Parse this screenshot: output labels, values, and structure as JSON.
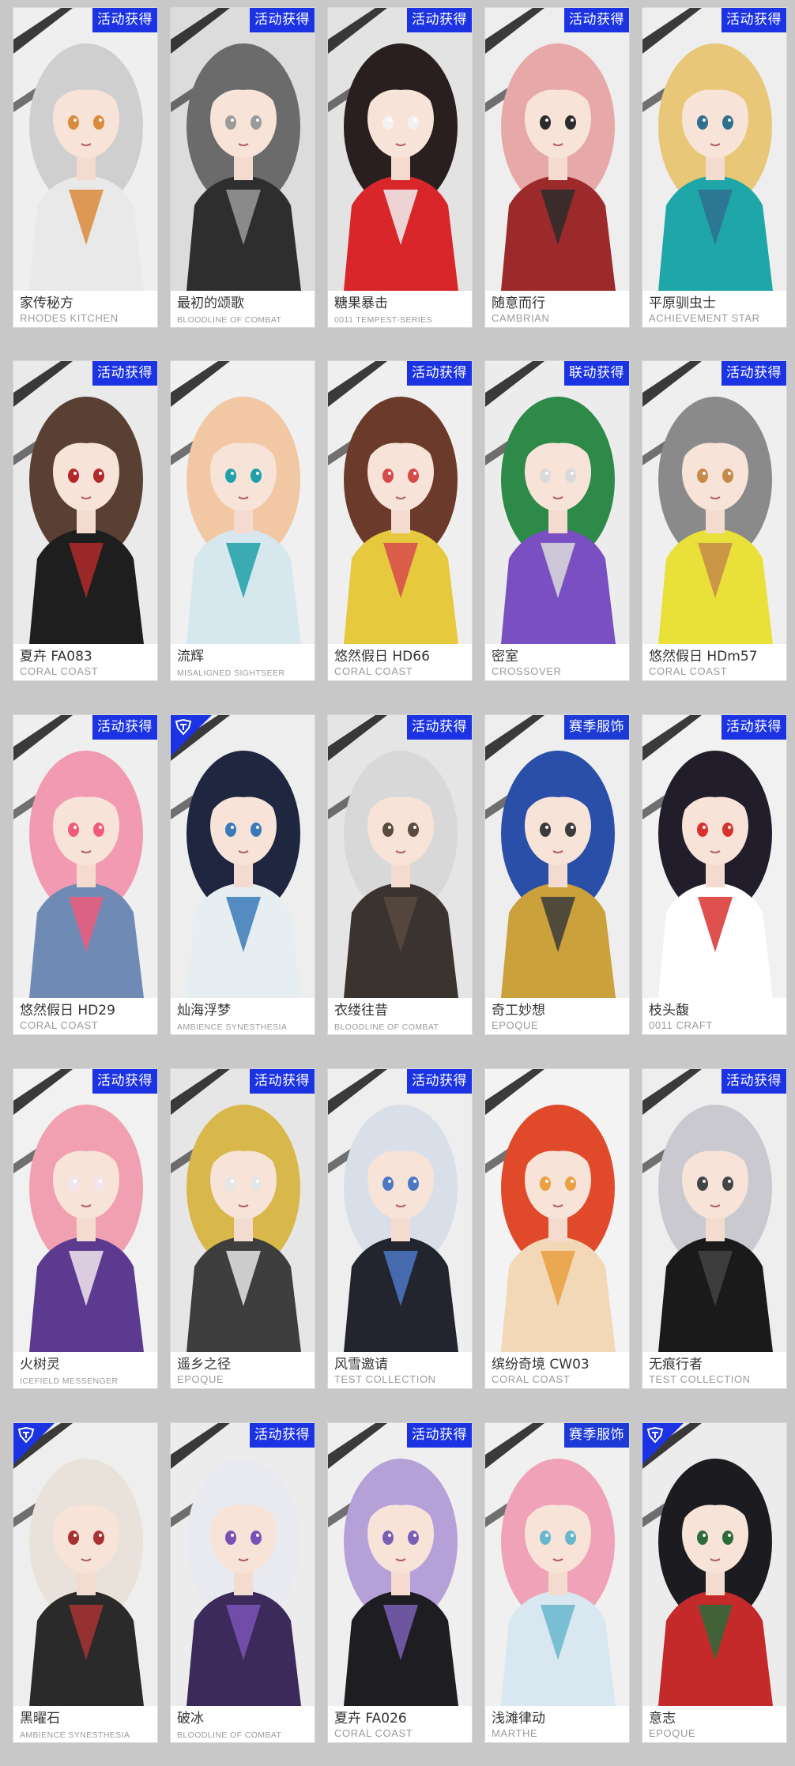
{
  "badges": {
    "event": "活动获得",
    "collab": "联动获得",
    "season": "赛季服饰"
  },
  "cards": [
    {
      "name": "家传秘方",
      "series": "RHODES KITCHEN",
      "badge": "活动获得",
      "badge_type": "event",
      "hair": "#cfcfcf",
      "outfit": "#e9e9e9",
      "accent": "#d98a3a",
      "bg": "#efefef"
    },
    {
      "name": "最初的颂歌",
      "series": "BLOODLINE OF COMBAT",
      "badge": "活动获得",
      "badge_type": "event",
      "hair": "#6b6b6b",
      "outfit": "#2e2e2e",
      "accent": "#9a9a9a",
      "bg": "#dcdcdc"
    },
    {
      "name": "糖果暴击",
      "series": "0011 TEMPEST-SERIES",
      "badge": "活动获得",
      "badge_type": "event",
      "hair": "#2a1f1f",
      "outfit": "#d8262a",
      "accent": "#f2f2f2",
      "bg": "#e3e3e3"
    },
    {
      "name": "随意而行",
      "series": "CAMBRIAN",
      "badge": "活动获得",
      "badge_type": "event",
      "hair": "#e7a9a7",
      "outfit": "#9c2a2a",
      "accent": "#2b2b2b",
      "bg": "#eeeeee"
    },
    {
      "name": "平原驯虫士",
      "series": "ACHIEVEMENT STAR",
      "badge": "活动获得",
      "badge_type": "event",
      "hair": "#e8c778",
      "outfit": "#1ea6a8",
      "accent": "#2f6f8f",
      "bg": "#eeeeee"
    },
    {
      "name": "夏卉 FA083",
      "series": "CORAL COAST",
      "badge": "活动获得",
      "badge_type": "event",
      "hair": "#5a4032",
      "outfit": "#1e1e1e",
      "accent": "#b02a2a",
      "bg": "#eaeaea"
    },
    {
      "name": "流辉",
      "series": "MISALIGNED SIGHTSEER",
      "badge": "",
      "badge_type": "none",
      "hair": "#f1c7a4",
      "outfit": "#d7e7ee",
      "accent": "#1fa0a8",
      "bg": "#f0f0f0"
    },
    {
      "name": "悠然假日 HD66",
      "series": "CORAL COAST",
      "badge": "活动获得",
      "badge_type": "event",
      "hair": "#6b3a2a",
      "outfit": "#e7c93e",
      "accent": "#d64a4a",
      "bg": "#efefef"
    },
    {
      "name": "密室",
      "series": "CROSSOVER",
      "badge": "联动获得",
      "badge_type": "collab",
      "hair": "#2d8a48",
      "outfit": "#7a4fc2",
      "accent": "#dadada",
      "bg": "#ececec"
    },
    {
      "name": "悠然假日 HDm57",
      "series": "CORAL COAST",
      "badge": "活动获得",
      "badge_type": "event",
      "hair": "#8a8a8a",
      "outfit": "#e9e03a",
      "accent": "#c48a4a",
      "bg": "#efefef"
    },
    {
      "name": "悠然假日 HD29",
      "series": "CORAL COAST",
      "badge": "活动获得",
      "badge_type": "event",
      "hair": "#f19ab2",
      "outfit": "#6f8bb5",
      "accent": "#f05b7a",
      "bg": "#efefef"
    },
    {
      "name": "灿海浮梦",
      "series": "AMBIENCE SYNESTHESIA",
      "badge": "",
      "badge_type": "corner",
      "hair": "#1f2640",
      "outfit": "#e6eef2",
      "accent": "#3a7ab8",
      "bg": "#eeeeee"
    },
    {
      "name": "衣缕往昔",
      "series": "BLOODLINE OF COMBAT",
      "badge": "活动获得",
      "badge_type": "event",
      "hair": "#d8d8d8",
      "outfit": "#3b3330",
      "accent": "#5a4a40",
      "bg": "#e5e5e5"
    },
    {
      "name": "奇工妙想",
      "series": "EPOQUE",
      "badge": "赛季服饰",
      "badge_type": "season",
      "hair": "#2a4fa8",
      "outfit": "#caa13a",
      "accent": "#3b3b3b",
      "bg": "#eeeeee"
    },
    {
      "name": "枝头馥",
      "series": "0011 CRAFT",
      "badge": "活动获得",
      "badge_type": "event",
      "hair": "#221d2a",
      "outfit": "#ffffff",
      "accent": "#d8322f",
      "bg": "#f1f1f1"
    },
    {
      "name": "火树灵",
      "series": "ICEFIELD MESSENGER",
      "badge": "活动获得",
      "badge_type": "event",
      "hair": "#f0a0b0",
      "outfit": "#5b3a8f",
      "accent": "#f2e6ee",
      "bg": "#f1f1f1"
    },
    {
      "name": "遥乡之径",
      "series": "EPOQUE",
      "badge": "活动获得",
      "badge_type": "event",
      "hair": "#d8b84a",
      "outfit": "#3e3e3e",
      "accent": "#e6e6e6",
      "bg": "#e6e6e6"
    },
    {
      "name": "风雪邀请",
      "series": "TEST COLLECTION",
      "badge": "活动获得",
      "badge_type": "event",
      "hair": "#d9dfe8",
      "outfit": "#22252e",
      "accent": "#4b77c4",
      "bg": "#eeeeee"
    },
    {
      "name": "缤纷奇境 CW03",
      "series": "CORAL COAST",
      "badge": "",
      "badge_type": "none",
      "hair": "#e04a2a",
      "outfit": "#f3d8b8",
      "accent": "#e8a040",
      "bg": "#f3f3f3"
    },
    {
      "name": "无痕行者",
      "series": "TEST COLLECTION",
      "badge": "活动获得",
      "badge_type": "event",
      "hair": "#c9c9cf",
      "outfit": "#1a1a1a",
      "accent": "#444444",
      "bg": "#eeeeee"
    },
    {
      "name": "黑曜石",
      "series": "AMBIENCE SYNESTHESIA",
      "badge": "",
      "badge_type": "corner",
      "hair": "#e8e2da",
      "outfit": "#2a2a2a",
      "accent": "#a83232",
      "bg": "#eeeeee"
    },
    {
      "name": "破冰",
      "series": "BLOODLINE OF COMBAT",
      "badge": "活动获得",
      "badge_type": "event",
      "hair": "#e9e9f0",
      "outfit": "#3c2a5a",
      "accent": "#7a52b6",
      "bg": "#ececec"
    },
    {
      "name": "夏卉 FA026",
      "series": "CORAL COAST",
      "badge": "活动获得",
      "badge_type": "event",
      "hair": "#b6a0d8",
      "outfit": "#1e1e22",
      "accent": "#7c5fb5",
      "bg": "#efefef"
    },
    {
      "name": "浅滩律动",
      "series": "MARTHE",
      "badge": "赛季服饰",
      "badge_type": "season",
      "hair": "#f0a2b8",
      "outfit": "#d9e8f0",
      "accent": "#69b6cf",
      "bg": "#f0f0f0"
    },
    {
      "name": "意志",
      "series": "EPOQUE",
      "badge": "",
      "badge_type": "corner",
      "hair": "#1c1c20",
      "outfit": "#c42a2a",
      "accent": "#2d6b3a",
      "bg": "#ececec"
    }
  ]
}
